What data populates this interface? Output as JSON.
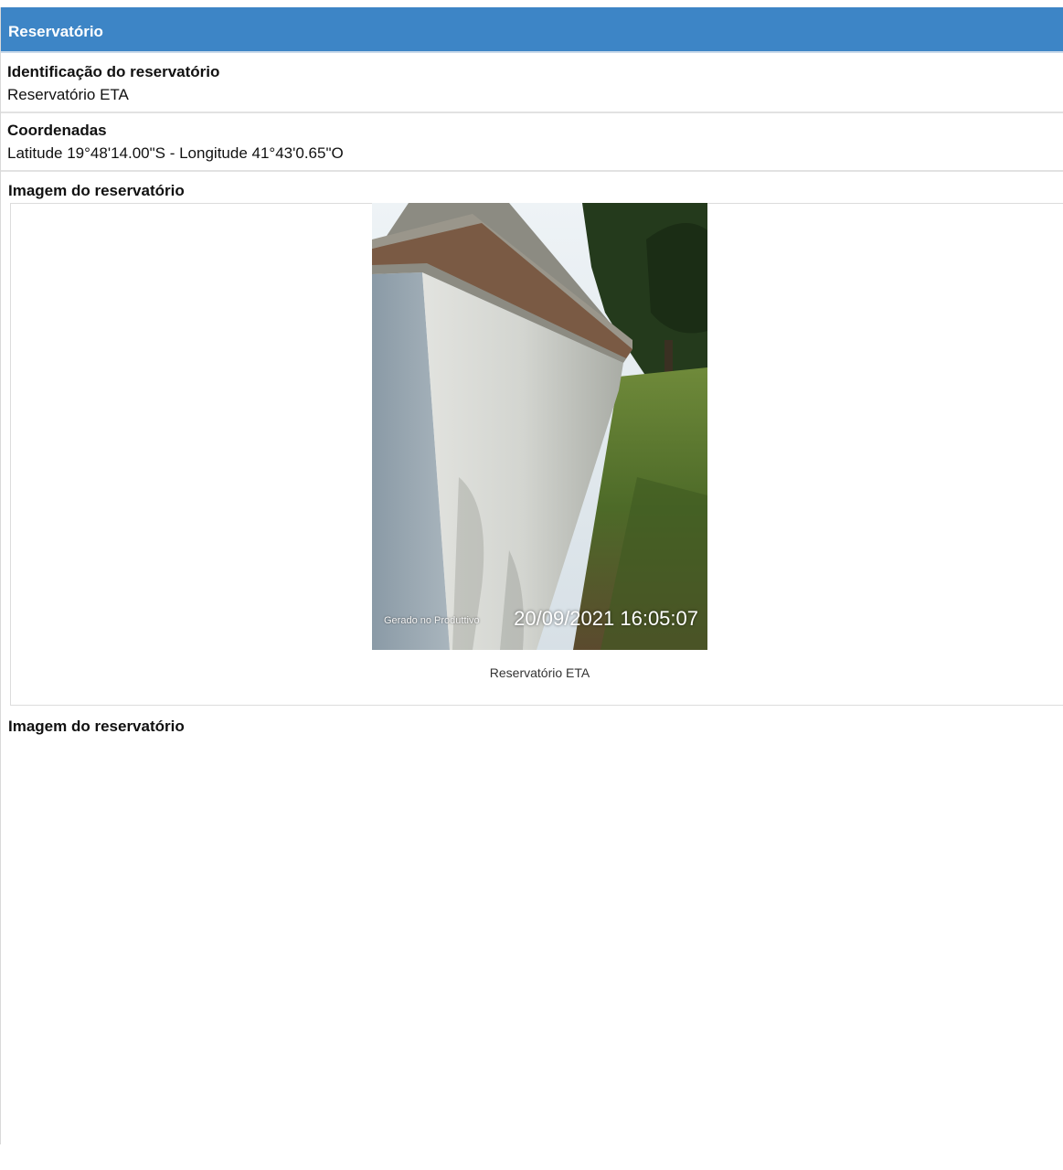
{
  "section": {
    "title": "Reservatório"
  },
  "identificacao": {
    "label": "Identificação do reservatório",
    "value": "Reservatório ETA"
  },
  "coordenadas": {
    "label": "Coordenadas",
    "value": "Latitude 19°48'14.00\"S - Longitude 41°43'0.65\"O"
  },
  "images": [
    {
      "label": "Imagem do reservatório",
      "stamp_app": "Gerado no Produttivo",
      "stamp_datetime": "20/09/2021 16:05:07",
      "caption": "Reservatório ETA",
      "photo_icon": "reservoir-wall-photo"
    },
    {
      "label": "Imagem do reservatório"
    }
  ],
  "colors": {
    "header_bg": "#3d85c6",
    "header_text": "#ffffff"
  }
}
